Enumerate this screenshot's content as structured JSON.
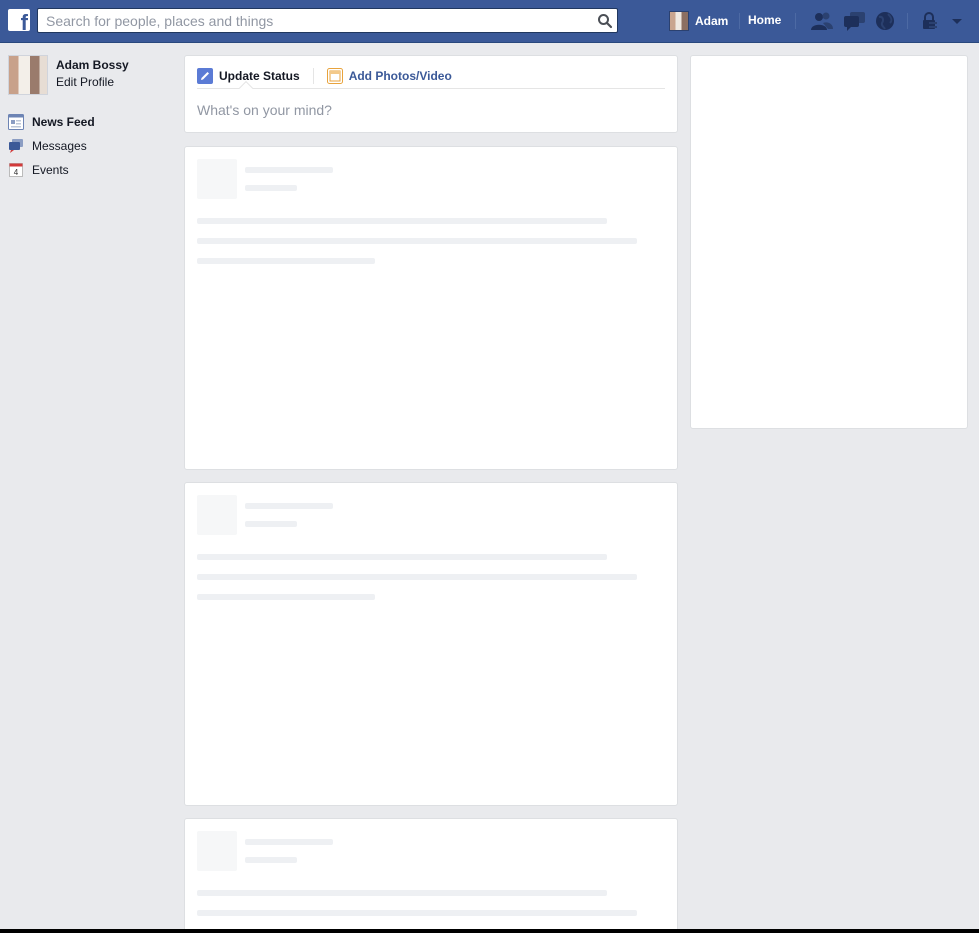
{
  "topbar": {
    "logo_letter": "f",
    "search_placeholder": "Search for people, places and things",
    "user_name": "Adam",
    "home_label": "Home",
    "jewels": [
      "friend-requests-icon",
      "messages-icon",
      "notifications-icon",
      "privacy-icon",
      "account-menu-icon"
    ],
    "colors": {
      "bar": "#3b5998",
      "text": "#ffffff"
    }
  },
  "sidebar": {
    "profile_name": "Adam Bossy",
    "edit_profile_label": "Edit Profile",
    "items": [
      {
        "label": "News Feed",
        "icon": "news-feed-icon",
        "active": true
      },
      {
        "label": "Messages",
        "icon": "messages-icon",
        "active": false
      },
      {
        "label": "Events",
        "icon": "calendar-icon",
        "active": false,
        "icon_text": "4"
      }
    ]
  },
  "composer": {
    "update_status_label": "Update Status",
    "add_photos_label": "Add Photos/Video",
    "placeholder": "What's on your mind?"
  },
  "feed": {
    "loading_stories": 3
  }
}
